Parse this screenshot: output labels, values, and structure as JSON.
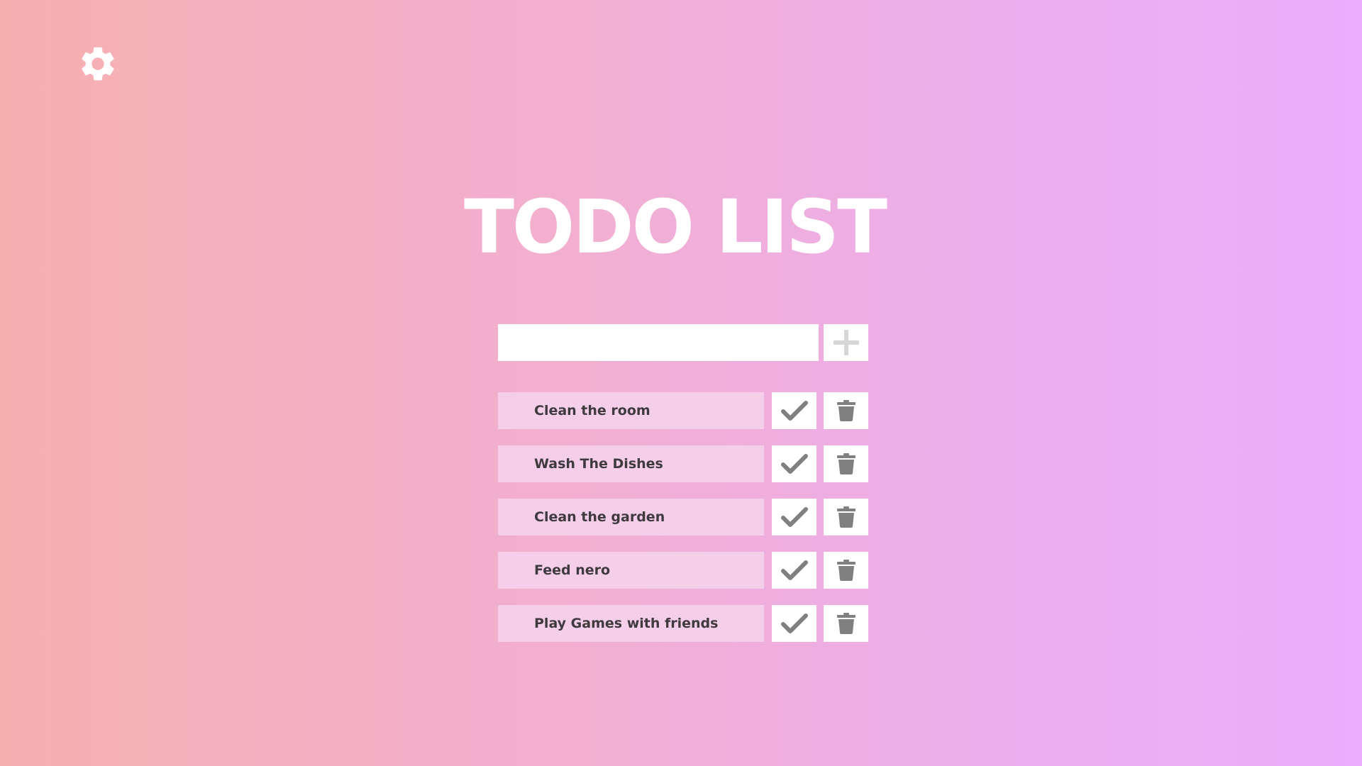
{
  "app": {
    "title": "TODO LIST"
  },
  "settings": {
    "icon": "gear-icon"
  },
  "new_task": {
    "value": "",
    "placeholder": "",
    "add_icon": "plus-icon"
  },
  "todos": [
    {
      "text": "Clean the room"
    },
    {
      "text": "Wash The Dishes"
    },
    {
      "text": "Clean the garden"
    },
    {
      "text": "Feed nero"
    },
    {
      "text": "Play Games with friends"
    }
  ],
  "item_actions": {
    "complete_icon": "check-icon",
    "delete_icon": "trash-icon"
  },
  "colors": {
    "background_start": "#f7b0b0",
    "background_end": "#ebadfc",
    "item_background": "#f5cfe9",
    "button_background": "#ffffff",
    "icon_gray": "#808080",
    "plus_gray": "#d6d6d6",
    "text_dark": "#3f3a3e"
  }
}
